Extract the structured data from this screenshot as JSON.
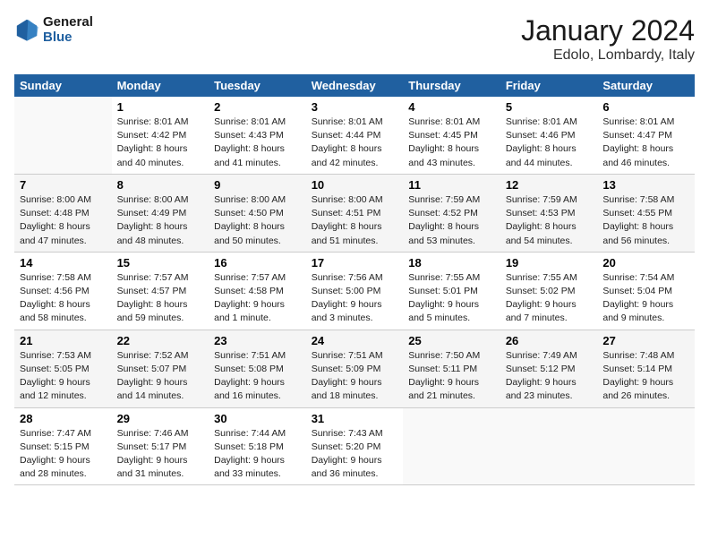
{
  "logo": {
    "line1": "General",
    "line2": "Blue"
  },
  "title": "January 2024",
  "location": "Edolo, Lombardy, Italy",
  "days_header": [
    "Sunday",
    "Monday",
    "Tuesday",
    "Wednesday",
    "Thursday",
    "Friday",
    "Saturday"
  ],
  "weeks": [
    [
      {
        "num": "",
        "sunrise": "",
        "sunset": "",
        "daylight": ""
      },
      {
        "num": "1",
        "sunrise": "Sunrise: 8:01 AM",
        "sunset": "Sunset: 4:42 PM",
        "daylight": "Daylight: 8 hours and 40 minutes."
      },
      {
        "num": "2",
        "sunrise": "Sunrise: 8:01 AM",
        "sunset": "Sunset: 4:43 PM",
        "daylight": "Daylight: 8 hours and 41 minutes."
      },
      {
        "num": "3",
        "sunrise": "Sunrise: 8:01 AM",
        "sunset": "Sunset: 4:44 PM",
        "daylight": "Daylight: 8 hours and 42 minutes."
      },
      {
        "num": "4",
        "sunrise": "Sunrise: 8:01 AM",
        "sunset": "Sunset: 4:45 PM",
        "daylight": "Daylight: 8 hours and 43 minutes."
      },
      {
        "num": "5",
        "sunrise": "Sunrise: 8:01 AM",
        "sunset": "Sunset: 4:46 PM",
        "daylight": "Daylight: 8 hours and 44 minutes."
      },
      {
        "num": "6",
        "sunrise": "Sunrise: 8:01 AM",
        "sunset": "Sunset: 4:47 PM",
        "daylight": "Daylight: 8 hours and 46 minutes."
      }
    ],
    [
      {
        "num": "7",
        "sunrise": "Sunrise: 8:00 AM",
        "sunset": "Sunset: 4:48 PM",
        "daylight": "Daylight: 8 hours and 47 minutes."
      },
      {
        "num": "8",
        "sunrise": "Sunrise: 8:00 AM",
        "sunset": "Sunset: 4:49 PM",
        "daylight": "Daylight: 8 hours and 48 minutes."
      },
      {
        "num": "9",
        "sunrise": "Sunrise: 8:00 AM",
        "sunset": "Sunset: 4:50 PM",
        "daylight": "Daylight: 8 hours and 50 minutes."
      },
      {
        "num": "10",
        "sunrise": "Sunrise: 8:00 AM",
        "sunset": "Sunset: 4:51 PM",
        "daylight": "Daylight: 8 hours and 51 minutes."
      },
      {
        "num": "11",
        "sunrise": "Sunrise: 7:59 AM",
        "sunset": "Sunset: 4:52 PM",
        "daylight": "Daylight: 8 hours and 53 minutes."
      },
      {
        "num": "12",
        "sunrise": "Sunrise: 7:59 AM",
        "sunset": "Sunset: 4:53 PM",
        "daylight": "Daylight: 8 hours and 54 minutes."
      },
      {
        "num": "13",
        "sunrise": "Sunrise: 7:58 AM",
        "sunset": "Sunset: 4:55 PM",
        "daylight": "Daylight: 8 hours and 56 minutes."
      }
    ],
    [
      {
        "num": "14",
        "sunrise": "Sunrise: 7:58 AM",
        "sunset": "Sunset: 4:56 PM",
        "daylight": "Daylight: 8 hours and 58 minutes."
      },
      {
        "num": "15",
        "sunrise": "Sunrise: 7:57 AM",
        "sunset": "Sunset: 4:57 PM",
        "daylight": "Daylight: 8 hours and 59 minutes."
      },
      {
        "num": "16",
        "sunrise": "Sunrise: 7:57 AM",
        "sunset": "Sunset: 4:58 PM",
        "daylight": "Daylight: 9 hours and 1 minute."
      },
      {
        "num": "17",
        "sunrise": "Sunrise: 7:56 AM",
        "sunset": "Sunset: 5:00 PM",
        "daylight": "Daylight: 9 hours and 3 minutes."
      },
      {
        "num": "18",
        "sunrise": "Sunrise: 7:55 AM",
        "sunset": "Sunset: 5:01 PM",
        "daylight": "Daylight: 9 hours and 5 minutes."
      },
      {
        "num": "19",
        "sunrise": "Sunrise: 7:55 AM",
        "sunset": "Sunset: 5:02 PM",
        "daylight": "Daylight: 9 hours and 7 minutes."
      },
      {
        "num": "20",
        "sunrise": "Sunrise: 7:54 AM",
        "sunset": "Sunset: 5:04 PM",
        "daylight": "Daylight: 9 hours and 9 minutes."
      }
    ],
    [
      {
        "num": "21",
        "sunrise": "Sunrise: 7:53 AM",
        "sunset": "Sunset: 5:05 PM",
        "daylight": "Daylight: 9 hours and 12 minutes."
      },
      {
        "num": "22",
        "sunrise": "Sunrise: 7:52 AM",
        "sunset": "Sunset: 5:07 PM",
        "daylight": "Daylight: 9 hours and 14 minutes."
      },
      {
        "num": "23",
        "sunrise": "Sunrise: 7:51 AM",
        "sunset": "Sunset: 5:08 PM",
        "daylight": "Daylight: 9 hours and 16 minutes."
      },
      {
        "num": "24",
        "sunrise": "Sunrise: 7:51 AM",
        "sunset": "Sunset: 5:09 PM",
        "daylight": "Daylight: 9 hours and 18 minutes."
      },
      {
        "num": "25",
        "sunrise": "Sunrise: 7:50 AM",
        "sunset": "Sunset: 5:11 PM",
        "daylight": "Daylight: 9 hours and 21 minutes."
      },
      {
        "num": "26",
        "sunrise": "Sunrise: 7:49 AM",
        "sunset": "Sunset: 5:12 PM",
        "daylight": "Daylight: 9 hours and 23 minutes."
      },
      {
        "num": "27",
        "sunrise": "Sunrise: 7:48 AM",
        "sunset": "Sunset: 5:14 PM",
        "daylight": "Daylight: 9 hours and 26 minutes."
      }
    ],
    [
      {
        "num": "28",
        "sunrise": "Sunrise: 7:47 AM",
        "sunset": "Sunset: 5:15 PM",
        "daylight": "Daylight: 9 hours and 28 minutes."
      },
      {
        "num": "29",
        "sunrise": "Sunrise: 7:46 AM",
        "sunset": "Sunset: 5:17 PM",
        "daylight": "Daylight: 9 hours and 31 minutes."
      },
      {
        "num": "30",
        "sunrise": "Sunrise: 7:44 AM",
        "sunset": "Sunset: 5:18 PM",
        "daylight": "Daylight: 9 hours and 33 minutes."
      },
      {
        "num": "31",
        "sunrise": "Sunrise: 7:43 AM",
        "sunset": "Sunset: 5:20 PM",
        "daylight": "Daylight: 9 hours and 36 minutes."
      },
      {
        "num": "",
        "sunrise": "",
        "sunset": "",
        "daylight": ""
      },
      {
        "num": "",
        "sunrise": "",
        "sunset": "",
        "daylight": ""
      },
      {
        "num": "",
        "sunrise": "",
        "sunset": "",
        "daylight": ""
      }
    ]
  ]
}
